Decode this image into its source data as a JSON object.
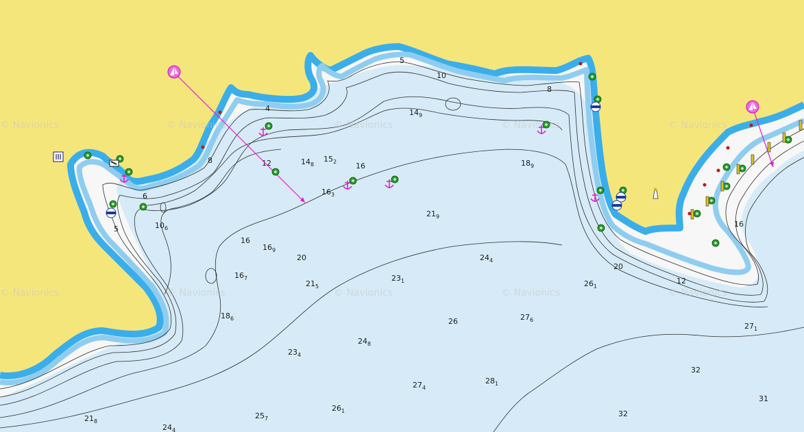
{
  "map": {
    "watermark": "© Navionics",
    "colors": {
      "land": "#f5e67c",
      "shallow": "#3aaeea",
      "mid": "#8fcdf0",
      "light": "#c8e6f6",
      "deep": "#f7f7f7",
      "contour": "#2b2b2b",
      "route": "#e020d0",
      "mooring_green": "#2aa12a"
    },
    "soundings": [
      {
        "main": "5",
        "sub": ""
      },
      {
        "main": "10",
        "sub": ""
      },
      {
        "main": "8",
        "sub": ""
      },
      {
        "main": "4",
        "sub": ""
      },
      {
        "main": "14",
        "sub": "9"
      },
      {
        "main": "14",
        "sub": "8"
      },
      {
        "main": "15",
        "sub": "2"
      },
      {
        "main": "16",
        "sub": ""
      },
      {
        "main": "18",
        "sub": "9"
      },
      {
        "main": "12",
        "sub": ""
      },
      {
        "main": "8",
        "sub": ""
      },
      {
        "main": "6",
        "sub": ""
      },
      {
        "main": "5",
        "sub": ""
      },
      {
        "main": "10",
        "sub": "6"
      },
      {
        "main": "16",
        "sub": "3"
      },
      {
        "main": "21",
        "sub": "9"
      },
      {
        "main": "16",
        "sub": ""
      },
      {
        "main": "16",
        "sub": "9"
      },
      {
        "main": "20",
        "sub": ""
      },
      {
        "main": "16",
        "sub": "7"
      },
      {
        "main": "21",
        "sub": "5"
      },
      {
        "main": "23",
        "sub": "1"
      },
      {
        "main": "24",
        "sub": "4"
      },
      {
        "main": "26",
        "sub": "1"
      },
      {
        "main": "20",
        "sub": ""
      },
      {
        "main": "12",
        "sub": ""
      },
      {
        "main": "16",
        "sub": ""
      },
      {
        "main": "18",
        "sub": "6"
      },
      {
        "main": "26",
        "sub": ""
      },
      {
        "main": "27",
        "sub": "6"
      },
      {
        "main": "24",
        "sub": "8"
      },
      {
        "main": "23",
        "sub": "4"
      },
      {
        "main": "27",
        "sub": "1"
      },
      {
        "main": "32",
        "sub": ""
      },
      {
        "main": "27",
        "sub": "4"
      },
      {
        "main": "28",
        "sub": "1"
      },
      {
        "main": "31",
        "sub": ""
      },
      {
        "main": "26",
        "sub": "1"
      },
      {
        "main": "32",
        "sub": ""
      },
      {
        "main": "21",
        "sub": "8"
      },
      {
        "main": "24",
        "sub": "4"
      },
      {
        "main": "25",
        "sub": "7"
      }
    ],
    "symbols": {
      "anchorages": 6,
      "moorings": 22,
      "buoys": 5,
      "yacht_routes": 2
    }
  }
}
